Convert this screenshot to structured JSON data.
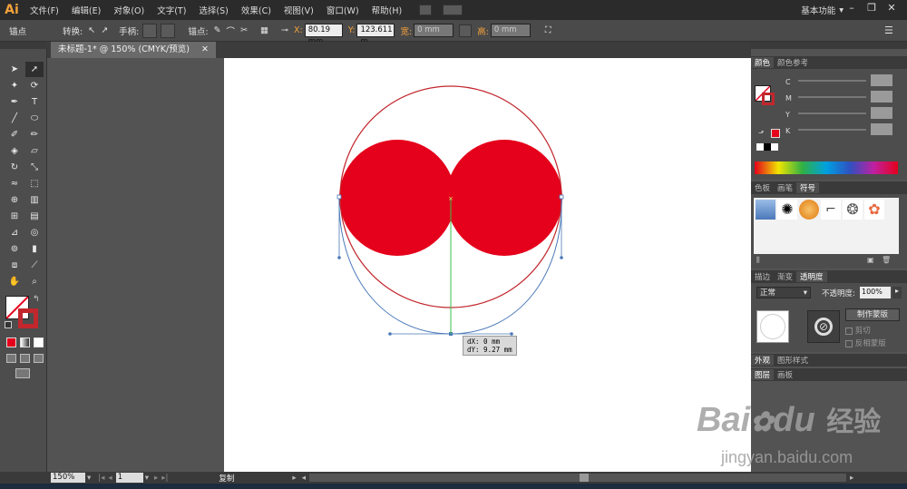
{
  "app": {
    "logo": "Ai",
    "workspace": "基本功能"
  },
  "menu": [
    "文件(F)",
    "编辑(E)",
    "对象(O)",
    "文字(T)",
    "选择(S)",
    "效果(C)",
    "视图(V)",
    "窗口(W)",
    "帮助(H)"
  ],
  "control": {
    "mode": "锚点",
    "convert": "转换:",
    "handle": "手柄:",
    "anchor": "锚点:",
    "x_label": "X:",
    "x_value": "80.19 mm",
    "y_label": "Y:",
    "y_value": "123.611 m",
    "w_label": "宽:",
    "w_value": "0 mm",
    "h_label": "高:",
    "h_value": "0 mm"
  },
  "document": {
    "tab_title": "未标题-1* @ 150% (CMYK/预览)"
  },
  "panels": {
    "color": {
      "tabs": [
        "颜色",
        "颜色参考"
      ],
      "channels": [
        "C",
        "M",
        "Y",
        "K"
      ]
    },
    "swatch": {
      "tabs": [
        "色板",
        "画笔",
        "符号"
      ]
    },
    "transparency": {
      "tabs": [
        "描边",
        "渐变",
        "透明度"
      ],
      "blend_mode": "正常",
      "opacity_label": "不透明度:",
      "opacity_value": "100%",
      "make_mask": "制作蒙版",
      "clip": "剪切",
      "invert_mask": "反相蒙版"
    },
    "appearance": {
      "tabs": [
        "外观",
        "图形样式"
      ]
    },
    "layers": {
      "tabs": [
        "图层",
        "画板"
      ]
    }
  },
  "tooltip": {
    "dx": "dX: 0 mm",
    "dy": "dY: 9.27 mm"
  },
  "status": {
    "zoom": "150%",
    "page": "1",
    "action": "复制"
  },
  "watermark": {
    "brand": "Bai",
    "brand2": "du",
    "cn": "经验",
    "url": "jingyan.baidu.com"
  },
  "colors": {
    "fill_red": "#e5001b",
    "circle_stroke": "#c1272d",
    "path_blue": "#4a78b8",
    "guide_green": "#39c24a",
    "accent": "#f4a13b"
  },
  "icons": [
    "selection-tool-icon",
    "direct-selection-tool-icon",
    "pen-tool-icon",
    "type-tool-icon",
    "hand-tool-icon",
    "zoom-tool-icon",
    "no-fill-swatch-icon",
    "mask-icon"
  ]
}
